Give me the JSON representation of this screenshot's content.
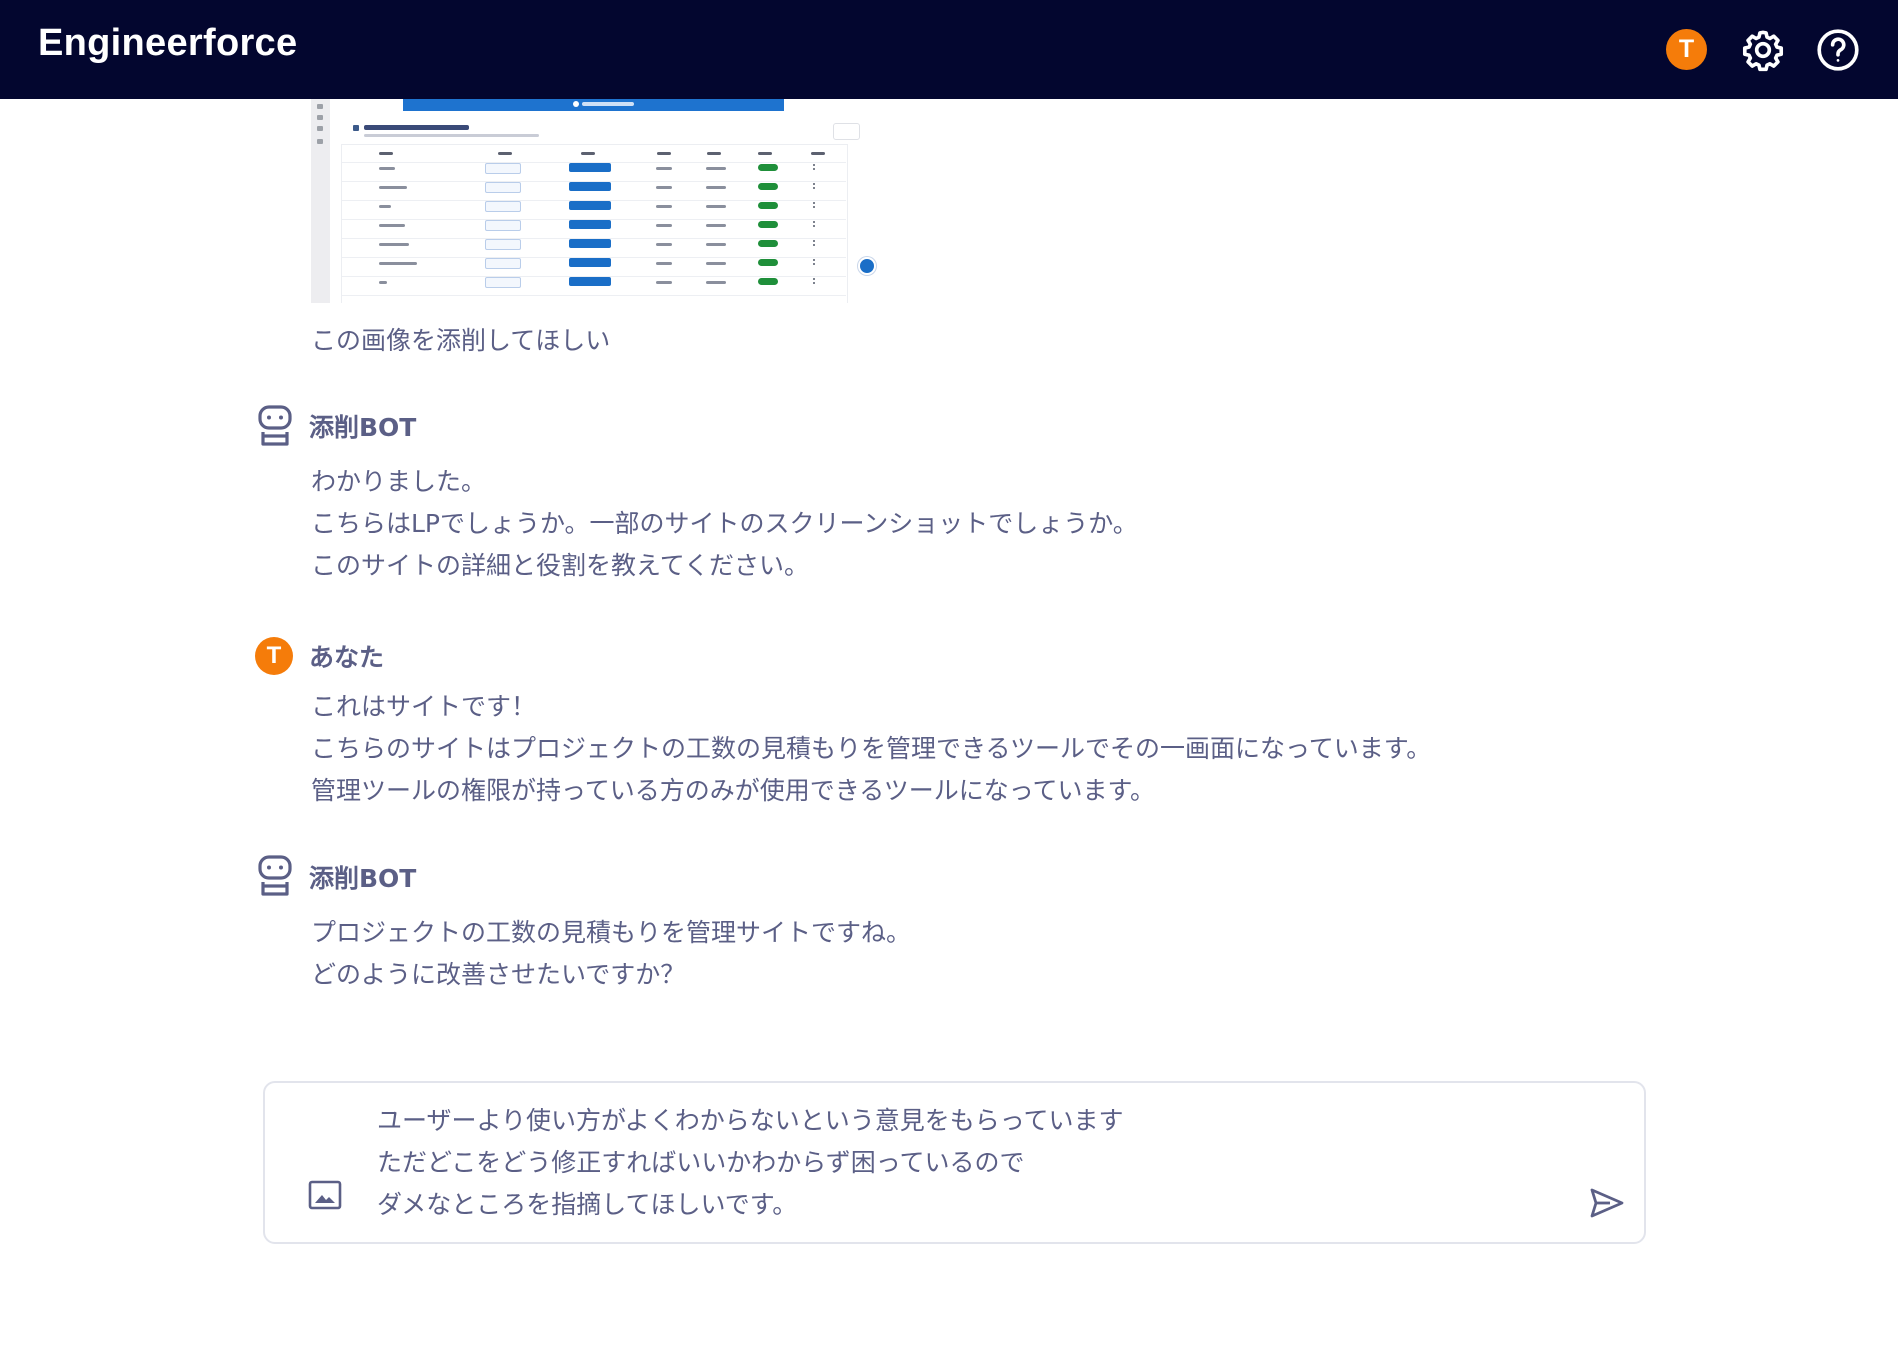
{
  "app": {
    "title": "Engineerforce",
    "user_initial": "T"
  },
  "messages": [
    {
      "speaker": "",
      "text": "この画像を添削してほしい"
    },
    {
      "speaker": "添削BOT",
      "text": "わかりました。\nこちらはLPでしょうか。一部のサイトのスクリーンショットでしょうか。\nこのサイトの詳細と役割を教えてください。"
    },
    {
      "speaker": "あなた",
      "text": "これはサイトです！\nこちらのサイトはプロジェクトの工数の見積もりを管理できるツールでその一画面になっています。\n管理ツールの権限が持っている方のみが使用できるツールになっています。"
    },
    {
      "speaker": "添削BOT",
      "text": "プロジェクトの工数の見積もりを管理サイトですね。\nどのように改善させたいですか？"
    }
  ],
  "composer": {
    "value": "ユーザーより使い方がよくわからないという意見をもらっています\nただどこをどう修正すればいいかわからず困っているので\nダメなところを指摘してほしいです。"
  },
  "icons": {
    "help": "help-icon",
    "settings": "gear-icon",
    "bot": "robot-icon",
    "attach": "image-icon",
    "send": "send-icon"
  },
  "colors": {
    "header_bg": "#03062f",
    "accent": "#f57c0a",
    "text": "#5b5f86",
    "thumb_primary": "#1a6ec7",
    "thumb_badge": "#1f8f3a"
  }
}
